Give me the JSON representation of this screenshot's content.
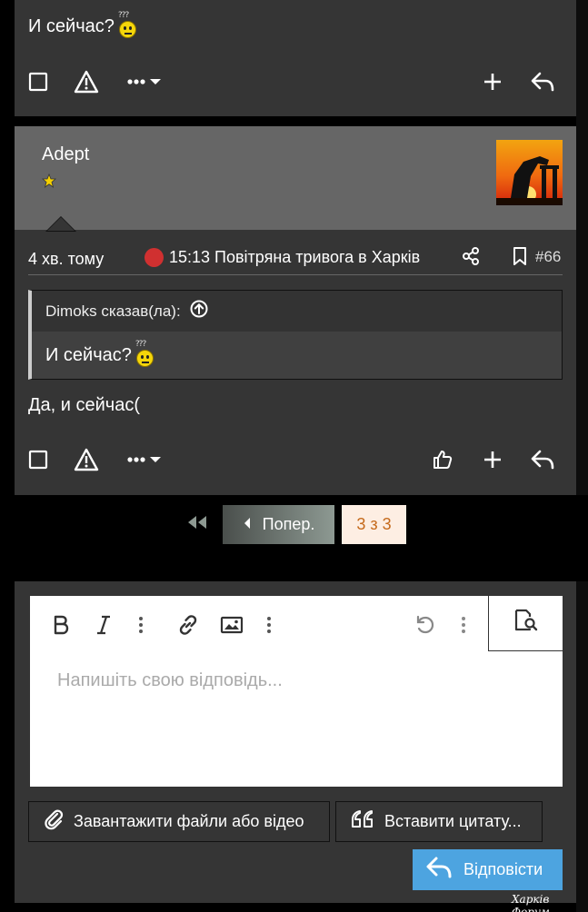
{
  "post1": {
    "text": "И сейчас?"
  },
  "post2": {
    "author": "Adept",
    "time": "4 хв. тому",
    "alert": "15:13 Повітряна тривога в Харків",
    "number": "#66",
    "quote": {
      "header": "Dimoks сказав(ла):",
      "text": "И сейчас?"
    },
    "text": "Да, и сейчас("
  },
  "pagination": {
    "prev_label": "Попер.",
    "current_label": "3 з 3"
  },
  "editor": {
    "placeholder": "Напишіть свою відповідь...",
    "upload_label": "Завантажити файли або відео",
    "quote_label": "Вставити цитату...",
    "send_label": "Відповісти"
  },
  "footer": {
    "brand": "Харків Форум"
  },
  "colors": {
    "accent_blue": "#4da4e0",
    "alert_red": "#d03030",
    "current_page_text": "#c56a1c"
  }
}
